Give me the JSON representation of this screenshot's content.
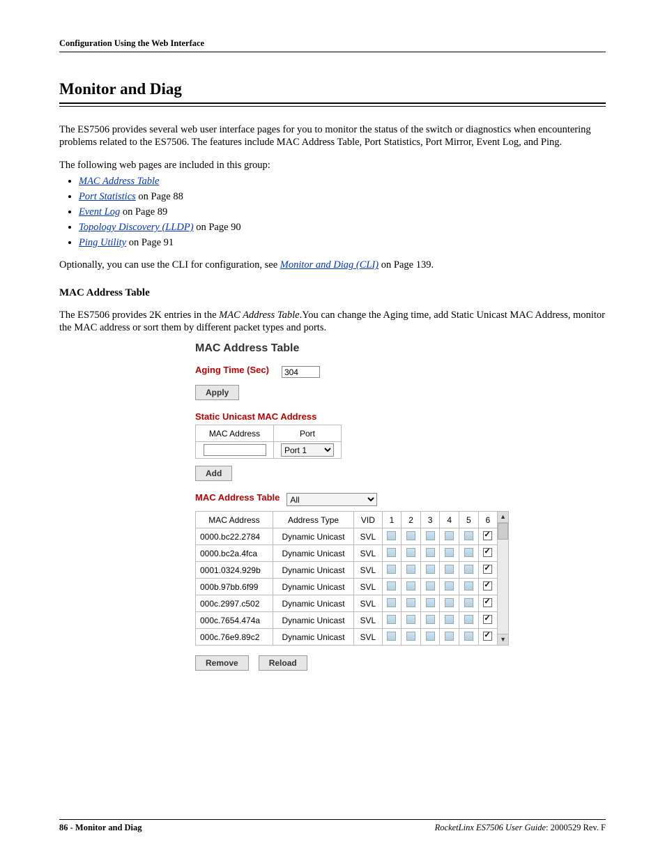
{
  "running_header": "Configuration Using the Web Interface",
  "section_title": "Monitor and Diag",
  "intro_para": "The ES7506 provides several web user interface pages for you to monitor the status of the switch or diagnostics when encountering problems related to the ES7506. The features include MAC Address Table, Port Statistics, Port Mirror, Event Log, and Ping.",
  "group_intro": "The following web pages are included in this group:",
  "links": [
    {
      "text": "MAC Address Table",
      "suffix": ""
    },
    {
      "text": "Port Statistics",
      "suffix": " on Page 88"
    },
    {
      "text": "Event Log",
      "suffix": " on Page 89"
    },
    {
      "text": "Topology Discovery (LLDP)",
      "suffix": " on Page 90"
    },
    {
      "text": "Ping Utility",
      "suffix": " on Page 91"
    }
  ],
  "cli_sentence_prefix": "Optionally, you can use the CLI for configuration, see ",
  "cli_link": "Monitor and Diag (CLI)",
  "cli_sentence_suffix": " on Page 139.",
  "subsection_title": "MAC Address Table",
  "subsection_para_pre": "The ES7506 provides 2K entries in the ",
  "subsection_para_italic": "MAC Address Table",
  "subsection_para_post": ".You can change the Aging time, add Static Unicast MAC Address, monitor the MAC address or sort them by different packet types and ports.",
  "ui": {
    "panel_title": "MAC Address Table",
    "aging_label": "Aging Time (Sec)",
    "aging_value": "304",
    "apply_label": "Apply",
    "static_heading": "Static Unicast MAC Address",
    "static_cols": {
      "mac": "MAC Address",
      "port": "Port"
    },
    "port_select_value": "Port 1",
    "add_label": "Add",
    "table_heading": "MAC Address Table",
    "filter_value": "All",
    "cols": {
      "mac": "MAC Address",
      "type": "Address Type",
      "vid": "VID",
      "p1": "1",
      "p2": "2",
      "p3": "3",
      "p4": "4",
      "p5": "5",
      "p6": "6"
    },
    "rows": [
      {
        "mac": "0000.bc22.2784",
        "type": "Dynamic Unicast",
        "vid": "SVL",
        "port": 6
      },
      {
        "mac": "0000.bc2a.4fca",
        "type": "Dynamic Unicast",
        "vid": "SVL",
        "port": 6
      },
      {
        "mac": "0001.0324.929b",
        "type": "Dynamic Unicast",
        "vid": "SVL",
        "port": 6
      },
      {
        "mac": "000b.97bb.6f99",
        "type": "Dynamic Unicast",
        "vid": "SVL",
        "port": 6
      },
      {
        "mac": "000c.2997.c502",
        "type": "Dynamic Unicast",
        "vid": "SVL",
        "port": 6
      },
      {
        "mac": "000c.7654.474a",
        "type": "Dynamic Unicast",
        "vid": "SVL",
        "port": 6
      },
      {
        "mac": "000c.76e9.89c2",
        "type": "Dynamic Unicast",
        "vid": "SVL",
        "port": 6
      }
    ],
    "remove_label": "Remove",
    "reload_label": "Reload"
  },
  "footer": {
    "page_num": "86",
    "section": "Monitor and Diag",
    "doc_title": "RocketLinx ES7506  User Guide",
    "doc_rev": ": 2000529 Rev. F"
  }
}
